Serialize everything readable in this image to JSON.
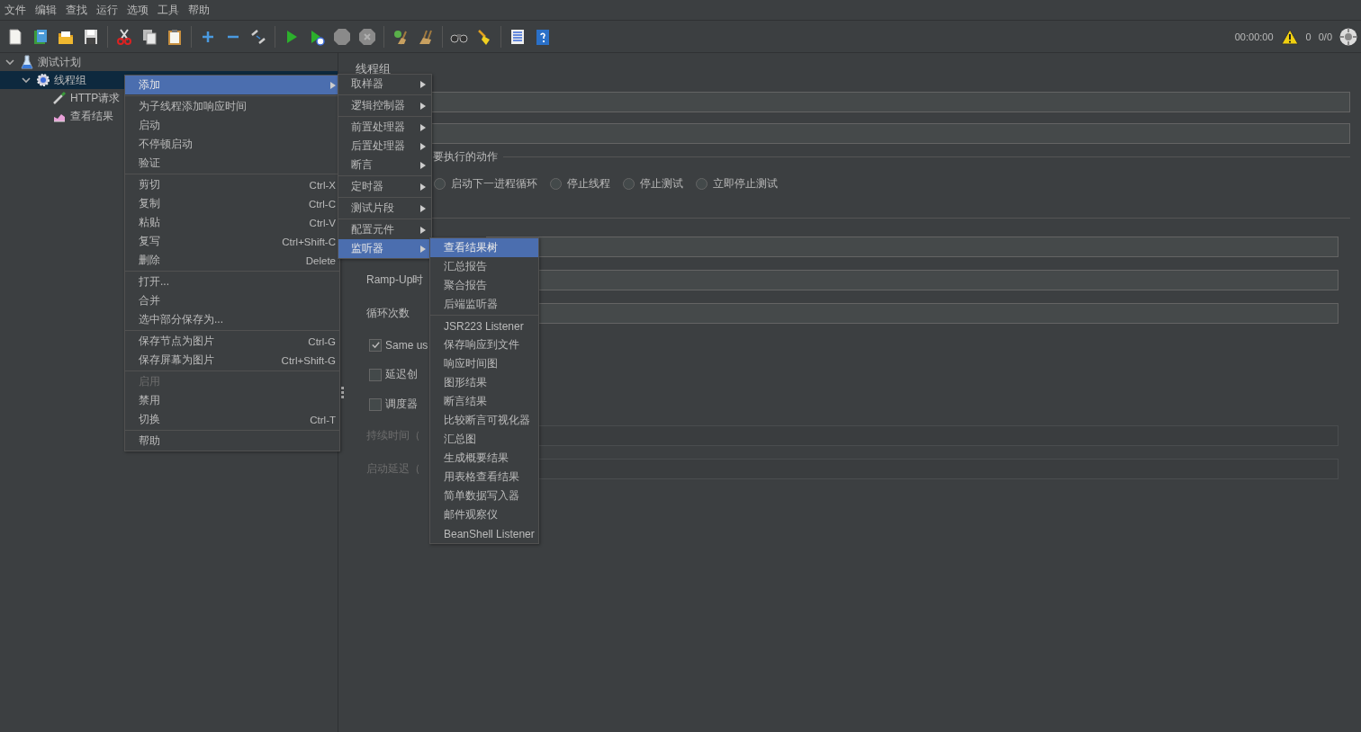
{
  "menu_bar": [
    "文件",
    "编辑",
    "查找",
    "运行",
    "选项",
    "工具",
    "帮助"
  ],
  "status": {
    "time": "00:00:00",
    "errors": "0",
    "threads": "0/0"
  },
  "tree": [
    {
      "label": "测试计划",
      "kind": "plan",
      "expanded": true,
      "selected": false,
      "children": [
        {
          "label": "线程组",
          "kind": "group",
          "expanded": true,
          "selected": true,
          "children": [
            {
              "label": "HTTP请求",
              "kind": "sampler",
              "selected": false
            },
            {
              "label": "查看结果",
              "kind": "listener",
              "selected": false
            }
          ]
        }
      ]
    }
  ],
  "panel": {
    "title": "线程组",
    "error_action": {
      "legend": "要执行的动作",
      "options": [
        {
          "label": "启动下一进程循环",
          "selected": false
        },
        {
          "label": "停止线程",
          "selected": false
        },
        {
          "label": "停止测试",
          "selected": false
        },
        {
          "label": "立即停止测试",
          "selected": false
        }
      ]
    },
    "properties": [
      {
        "kind": "field",
        "disabled": false
      },
      {
        "kind": "field",
        "label": "Ramp-Up时",
        "disabled": false
      },
      {
        "kind": "field",
        "label": "循环次数",
        "disabled": false
      },
      {
        "kind": "checkbox",
        "label": "Same us",
        "checked": true
      },
      {
        "kind": "checkbox",
        "label": "延迟创",
        "checked": false
      },
      {
        "kind": "checkbox",
        "label": "调度器",
        "checked": false
      },
      {
        "kind": "field",
        "label": "持续时间（",
        "disabled": true
      },
      {
        "kind": "field",
        "label": "启动延迟（",
        "disabled": true
      }
    ]
  },
  "context_menu": {
    "groups": [
      [
        {
          "label": "添加",
          "selected": true,
          "disabled": false,
          "submenu": true
        }
      ],
      [
        {
          "label": "为子线程添加响应时间",
          "selected": false,
          "disabled": false,
          "submenu": false
        },
        {
          "label": "启动",
          "selected": false,
          "disabled": false,
          "submenu": false
        },
        {
          "label": "不停顿启动",
          "selected": false,
          "disabled": false,
          "submenu": false
        },
        {
          "label": "验证",
          "selected": false,
          "disabled": false,
          "submenu": false
        }
      ],
      [
        {
          "label": "剪切",
          "shortcut": "Ctrl-X",
          "selected": false,
          "disabled": false,
          "submenu": false
        },
        {
          "label": "复制",
          "shortcut": "Ctrl-C",
          "selected": false,
          "disabled": false,
          "submenu": false
        },
        {
          "label": "粘贴",
          "shortcut": "Ctrl-V",
          "selected": false,
          "disabled": false,
          "submenu": false
        },
        {
          "label": "复写",
          "shortcut": "Ctrl+Shift-C",
          "selected": false,
          "disabled": false,
          "submenu": false
        },
        {
          "label": "删除",
          "shortcut": "Delete",
          "selected": false,
          "disabled": false,
          "submenu": false
        }
      ],
      [
        {
          "label": "打开...",
          "selected": false,
          "disabled": false,
          "submenu": false
        },
        {
          "label": "合并",
          "selected": false,
          "disabled": false,
          "submenu": false
        },
        {
          "label": "选中部分保存为...",
          "selected": false,
          "disabled": false,
          "submenu": false
        }
      ],
      [
        {
          "label": "保存节点为图片",
          "shortcut": "Ctrl-G",
          "selected": false,
          "disabled": false,
          "submenu": false
        },
        {
          "label": "保存屏幕为图片",
          "shortcut": "Ctrl+Shift-G",
          "selected": false,
          "disabled": false,
          "submenu": false
        }
      ],
      [
        {
          "label": "启用",
          "selected": false,
          "disabled": true,
          "submenu": false
        },
        {
          "label": "禁用",
          "selected": false,
          "disabled": false,
          "submenu": false
        },
        {
          "label": "切换",
          "shortcut": "Ctrl-T",
          "selected": false,
          "disabled": false,
          "submenu": false
        }
      ],
      [
        {
          "label": "帮助",
          "selected": false,
          "disabled": false,
          "submenu": false
        }
      ]
    ]
  },
  "add_menu": {
    "groups": [
      [
        {
          "label": "取样器",
          "selected": false,
          "disabled": false,
          "submenu": true
        }
      ],
      [
        {
          "label": "逻辑控制器",
          "selected": false,
          "disabled": false,
          "submenu": true
        }
      ],
      [
        {
          "label": "前置处理器",
          "selected": false,
          "disabled": false,
          "submenu": true
        },
        {
          "label": "后置处理器",
          "selected": false,
          "disabled": false,
          "submenu": true
        },
        {
          "label": "断言",
          "selected": false,
          "disabled": false,
          "submenu": true
        }
      ],
      [
        {
          "label": "定时器",
          "selected": false,
          "disabled": false,
          "submenu": true
        }
      ],
      [
        {
          "label": "测试片段",
          "selected": false,
          "disabled": false,
          "submenu": true
        }
      ],
      [
        {
          "label": "配置元件",
          "selected": false,
          "disabled": false,
          "submenu": true
        },
        {
          "label": "监听器",
          "selected": true,
          "disabled": false,
          "submenu": true
        }
      ]
    ]
  },
  "listener_menu": {
    "groups": [
      [
        {
          "label": "查看结果树",
          "selected": true,
          "disabled": false,
          "submenu": false
        },
        {
          "label": "汇总报告",
          "selected": false,
          "disabled": false,
          "submenu": false
        },
        {
          "label": "聚合报告",
          "selected": false,
          "disabled": false,
          "submenu": false
        },
        {
          "label": "后端监听器",
          "selected": false,
          "disabled": false,
          "submenu": false
        }
      ],
      [
        {
          "label": "JSR223 Listener",
          "selected": false,
          "disabled": false,
          "submenu": false
        },
        {
          "label": "保存响应到文件",
          "selected": false,
          "disabled": false,
          "submenu": false
        },
        {
          "label": "响应时间图",
          "selected": false,
          "disabled": false,
          "submenu": false
        },
        {
          "label": "图形结果",
          "selected": false,
          "disabled": false,
          "submenu": false
        },
        {
          "label": "断言结果",
          "selected": false,
          "disabled": false,
          "submenu": false
        },
        {
          "label": "比较断言可视化器",
          "selected": false,
          "disabled": false,
          "submenu": false
        },
        {
          "label": "汇总图",
          "selected": false,
          "disabled": false,
          "submenu": false
        },
        {
          "label": "生成概要结果",
          "selected": false,
          "disabled": false,
          "submenu": false
        },
        {
          "label": "用表格查看结果",
          "selected": false,
          "disabled": false,
          "submenu": false
        },
        {
          "label": "简单数据写入器",
          "selected": false,
          "disabled": false,
          "submenu": false
        },
        {
          "label": "邮件观察仪",
          "selected": false,
          "disabled": false,
          "submenu": false
        },
        {
          "label": "BeanShell Listener",
          "selected": false,
          "disabled": false,
          "submenu": false
        }
      ]
    ]
  }
}
